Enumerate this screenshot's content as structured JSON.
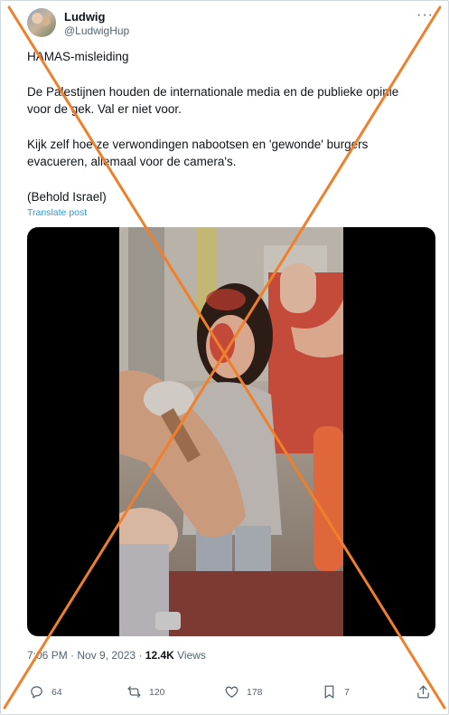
{
  "author": {
    "display_name": "Ludwig",
    "handle": "@LudwigHup",
    "avatar_icon": "avatar-photo"
  },
  "more_label": "···",
  "tweet": {
    "paragraphs": [
      "HAMAS-misleiding",
      "De Palestijnen houden de internationale media en de publieke opinie voor de gek. Val er niet voor.",
      "Kijk zelf hoe ze verwondingen nabootsen en 'gewonde' burgers evacueren, allemaal voor de camera's.",
      "(Behold Israel)"
    ],
    "translate_label": "Translate post"
  },
  "media": {
    "type": "video",
    "description_icon": "video-still"
  },
  "meta": {
    "time": "7:06 PM",
    "separator": " · ",
    "date": "Nov 9, 2023",
    "views_count": "12.4K",
    "views_label": " Views"
  },
  "actions": {
    "replies": "64",
    "reposts": "120",
    "likes": "178",
    "bookmarks": "7"
  },
  "colors": {
    "accent": "#1d9bf0",
    "secondary_text": "#536471",
    "cross": "#f07f2a"
  }
}
